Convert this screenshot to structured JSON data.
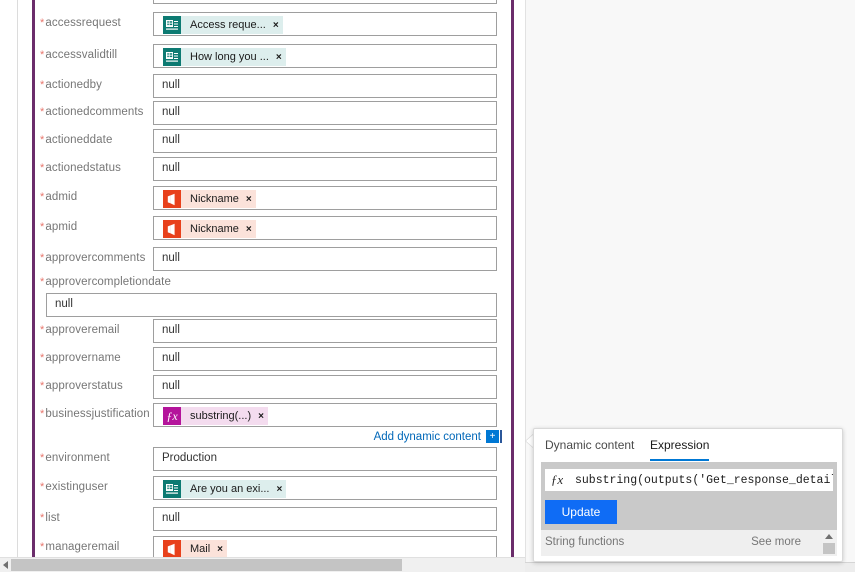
{
  "colors": {
    "accent_purple": "#6b2d6b",
    "required_star": "#e8766c",
    "link_blue": "#0067b8",
    "button_blue": "#0f6cf5",
    "forms_teal": "#0d7a72",
    "office_orange": "#e8411c",
    "fx_magenta": "#b4149b",
    "tab_underline": "#0078d4"
  },
  "form": {
    "fields": [
      {
        "label": "accessrequest",
        "type": "chip",
        "chip_style": "forms",
        "icon": "microsoft-forms-icon",
        "chip_label": "Access reque...",
        "remove": "×"
      },
      {
        "label": "accessvalidtill",
        "type": "chip",
        "chip_style": "forms",
        "icon": "microsoft-forms-icon",
        "chip_label": "How long you ...",
        "remove": "×"
      },
      {
        "label": "actionedby",
        "type": "text",
        "value": "null"
      },
      {
        "label": "actionedcomments",
        "type": "text",
        "value": "null"
      },
      {
        "label": "actioneddate",
        "type": "text",
        "value": "null"
      },
      {
        "label": "actionedstatus",
        "type": "text",
        "value": "null"
      },
      {
        "label": "admid",
        "type": "chip",
        "chip_style": "office",
        "icon": "office-365-users-icon",
        "chip_label": "Nickname",
        "remove": "×"
      },
      {
        "label": "apmid",
        "type": "chip",
        "chip_style": "office",
        "icon": "office-365-users-icon",
        "chip_label": "Nickname",
        "remove": "×"
      },
      {
        "label": "approvercomments",
        "type": "text",
        "value": "null"
      },
      {
        "label": "approvercompletiondate",
        "type": "text",
        "value": "null",
        "wide": true
      },
      {
        "label": "approveremail",
        "type": "text",
        "value": "null"
      },
      {
        "label": "approvername",
        "type": "text",
        "value": "null"
      },
      {
        "label": "approverstatus",
        "type": "text",
        "value": "null"
      },
      {
        "label": "businessjustification",
        "type": "chip",
        "chip_style": "fx",
        "icon": "fx-expression-icon",
        "chip_label": "substring(...)",
        "remove": "×"
      },
      {
        "label": "environment",
        "type": "text",
        "value": "Production"
      },
      {
        "label": "existinguser",
        "type": "chip",
        "chip_style": "forms",
        "icon": "microsoft-forms-icon",
        "chip_label": "Are you an exi...",
        "remove": "×"
      },
      {
        "label": "list",
        "type": "text",
        "value": "null"
      },
      {
        "label": "manageremail",
        "type": "chip",
        "chip_style": "office",
        "icon": "office-365-users-icon",
        "chip_label": "Mail",
        "remove": "×"
      }
    ],
    "required_marker": "*",
    "add_dynamic_content": {
      "label": "Add dynamic content",
      "plus": "+"
    }
  },
  "expression_panel": {
    "tabs": [
      {
        "label": "Dynamic content",
        "selected": false
      },
      {
        "label": "Expression",
        "selected": true
      }
    ],
    "fx_symbol": "ƒx",
    "expression_value": "substring(outputs('Get_response_detail",
    "update_button": "Update",
    "footer": {
      "category": "String functions",
      "see_more": "See more"
    }
  }
}
